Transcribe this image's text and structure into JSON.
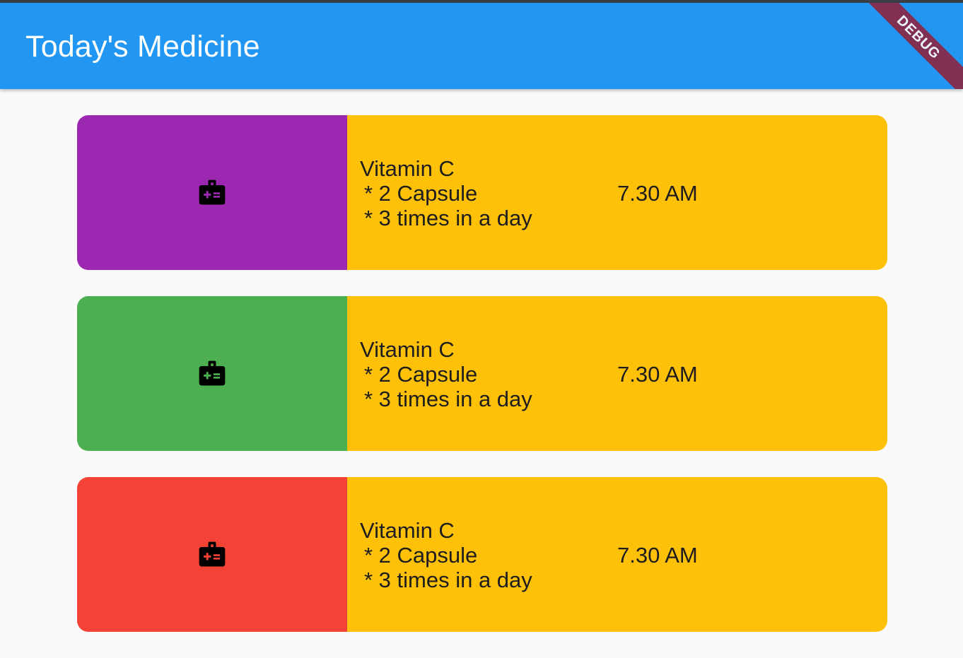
{
  "app": {
    "title": "Today's Medicine",
    "debug_banner": "DEBUG"
  },
  "theme": {
    "app_bar": "#2196f3",
    "info_panel": "#ffc107",
    "background": "#fafafa"
  },
  "medicines": [
    {
      "name": "Vitamin C",
      "dose": "* 2 Capsule",
      "frequency": "* 3 times in a day",
      "time": "7.30 AM",
      "icon": "medical-kit-icon",
      "panel_color": "#9c27b0"
    },
    {
      "name": "Vitamin C",
      "dose": "* 2 Capsule",
      "frequency": "* 3 times in a day",
      "time": "7.30 AM",
      "icon": "medical-kit-icon",
      "panel_color": "#4caf50"
    },
    {
      "name": "Vitamin C",
      "dose": "* 2 Capsule",
      "frequency": "* 3 times in a day",
      "time": "7.30 AM",
      "icon": "medical-kit-icon",
      "panel_color": "#f44336"
    }
  ]
}
